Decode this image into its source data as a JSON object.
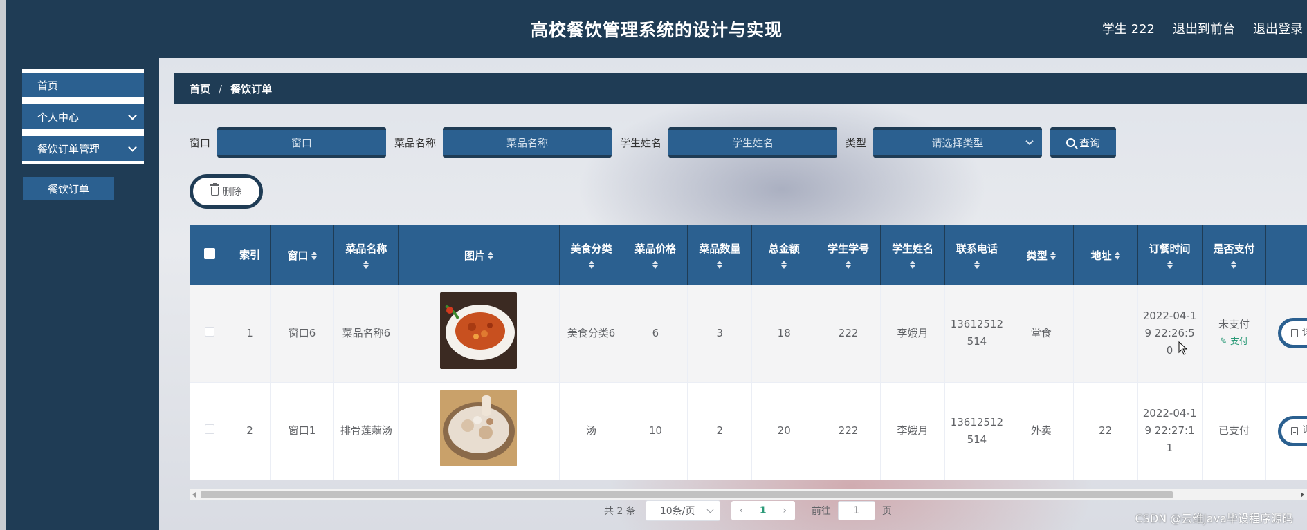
{
  "header": {
    "title": "高校餐饮管理系统的设计与实现",
    "user": "学生 222",
    "back_front": "退出到前台",
    "logout": "退出登录"
  },
  "sidebar": {
    "items": [
      {
        "label": "首页"
      },
      {
        "label": "个人中心"
      },
      {
        "label": "餐饮订单管理"
      }
    ],
    "sub_item": "餐饮订单"
  },
  "breadcrumb": {
    "home": "首页",
    "sep": "/",
    "current": "餐饮订单"
  },
  "filters": {
    "window_label": "窗口",
    "window_placeholder": "窗口",
    "dish_label": "菜品名称",
    "dish_placeholder": "菜品名称",
    "student_label": "学生姓名",
    "student_placeholder": "学生姓名",
    "type_label": "类型",
    "type_placeholder": "请选择类型",
    "search_label": "查询"
  },
  "actions": {
    "delete_label": "删除"
  },
  "table": {
    "columns": [
      "索引",
      "窗口",
      "菜品名称",
      "图片",
      "美食分类",
      "菜品价格",
      "菜品数量",
      "总金额",
      "学生学号",
      "学生姓名",
      "联系电话",
      "类型",
      "地址",
      "订餐时间",
      "是否支付",
      ""
    ],
    "rows": [
      {
        "index": "1",
        "window": "窗口6",
        "dish": "菜品名称6",
        "category": "美食分类6",
        "price": "6",
        "qty": "3",
        "total": "18",
        "student_no": "222",
        "student_name": "李娥月",
        "phone": "13612512514",
        "type": "堂食",
        "address": "",
        "time": "2022-04-19 22:26:50",
        "paid": "未支付",
        "pay_action": "支付",
        "detail": "详情"
      },
      {
        "index": "2",
        "window": "窗口1",
        "dish": "排骨莲藕汤",
        "category": "汤",
        "price": "10",
        "qty": "2",
        "total": "20",
        "student_no": "222",
        "student_name": "李娥月",
        "phone": "13612512514",
        "type": "外卖",
        "address": "22",
        "time": "2022-04-19 22:27:11",
        "paid": "已支付",
        "pay_action": "",
        "detail": "详情"
      }
    ]
  },
  "pagination": {
    "total": "共 2 条",
    "page_size": "10条/页",
    "current_page": "1",
    "goto_prefix": "前往",
    "goto_value": "1",
    "goto_suffix": "页"
  },
  "watermark": "CSDN @云维Java毕设程序源码",
  "colors": {
    "dark_navy": "#1f3c55",
    "accent_blue": "#2b6090",
    "link_green": "#2b9a78"
  }
}
